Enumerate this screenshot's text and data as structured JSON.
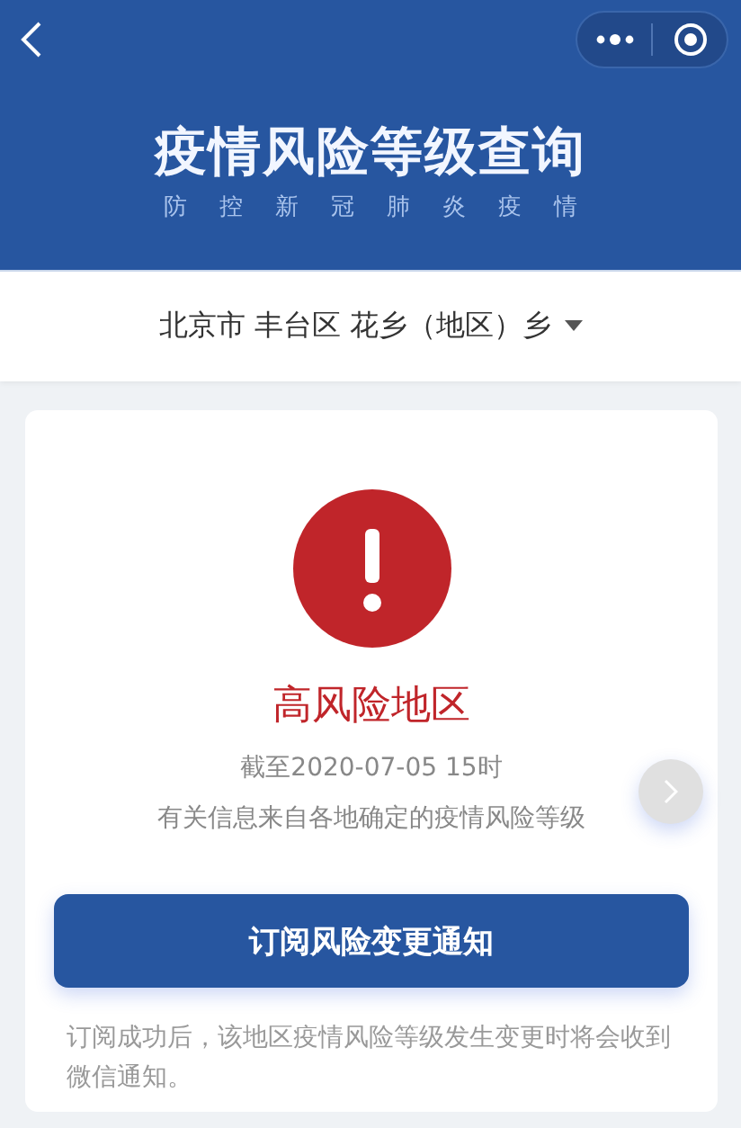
{
  "header": {
    "title": "疫情风险等级查询",
    "subtitle": "防控新冠肺炎疫情"
  },
  "location": {
    "label": "北京市 丰台区 花乡（地区）乡"
  },
  "result": {
    "kind": "high",
    "label": "高风险地区",
    "updated": "截至2020-07-05 15时",
    "source": "有关信息来自各地确定的疫情风险等级"
  },
  "subscribe_button": "订阅风险变更通知",
  "note": "订阅成功后，该地区疫情风险等级发生变更时将会收到微信通知。"
}
